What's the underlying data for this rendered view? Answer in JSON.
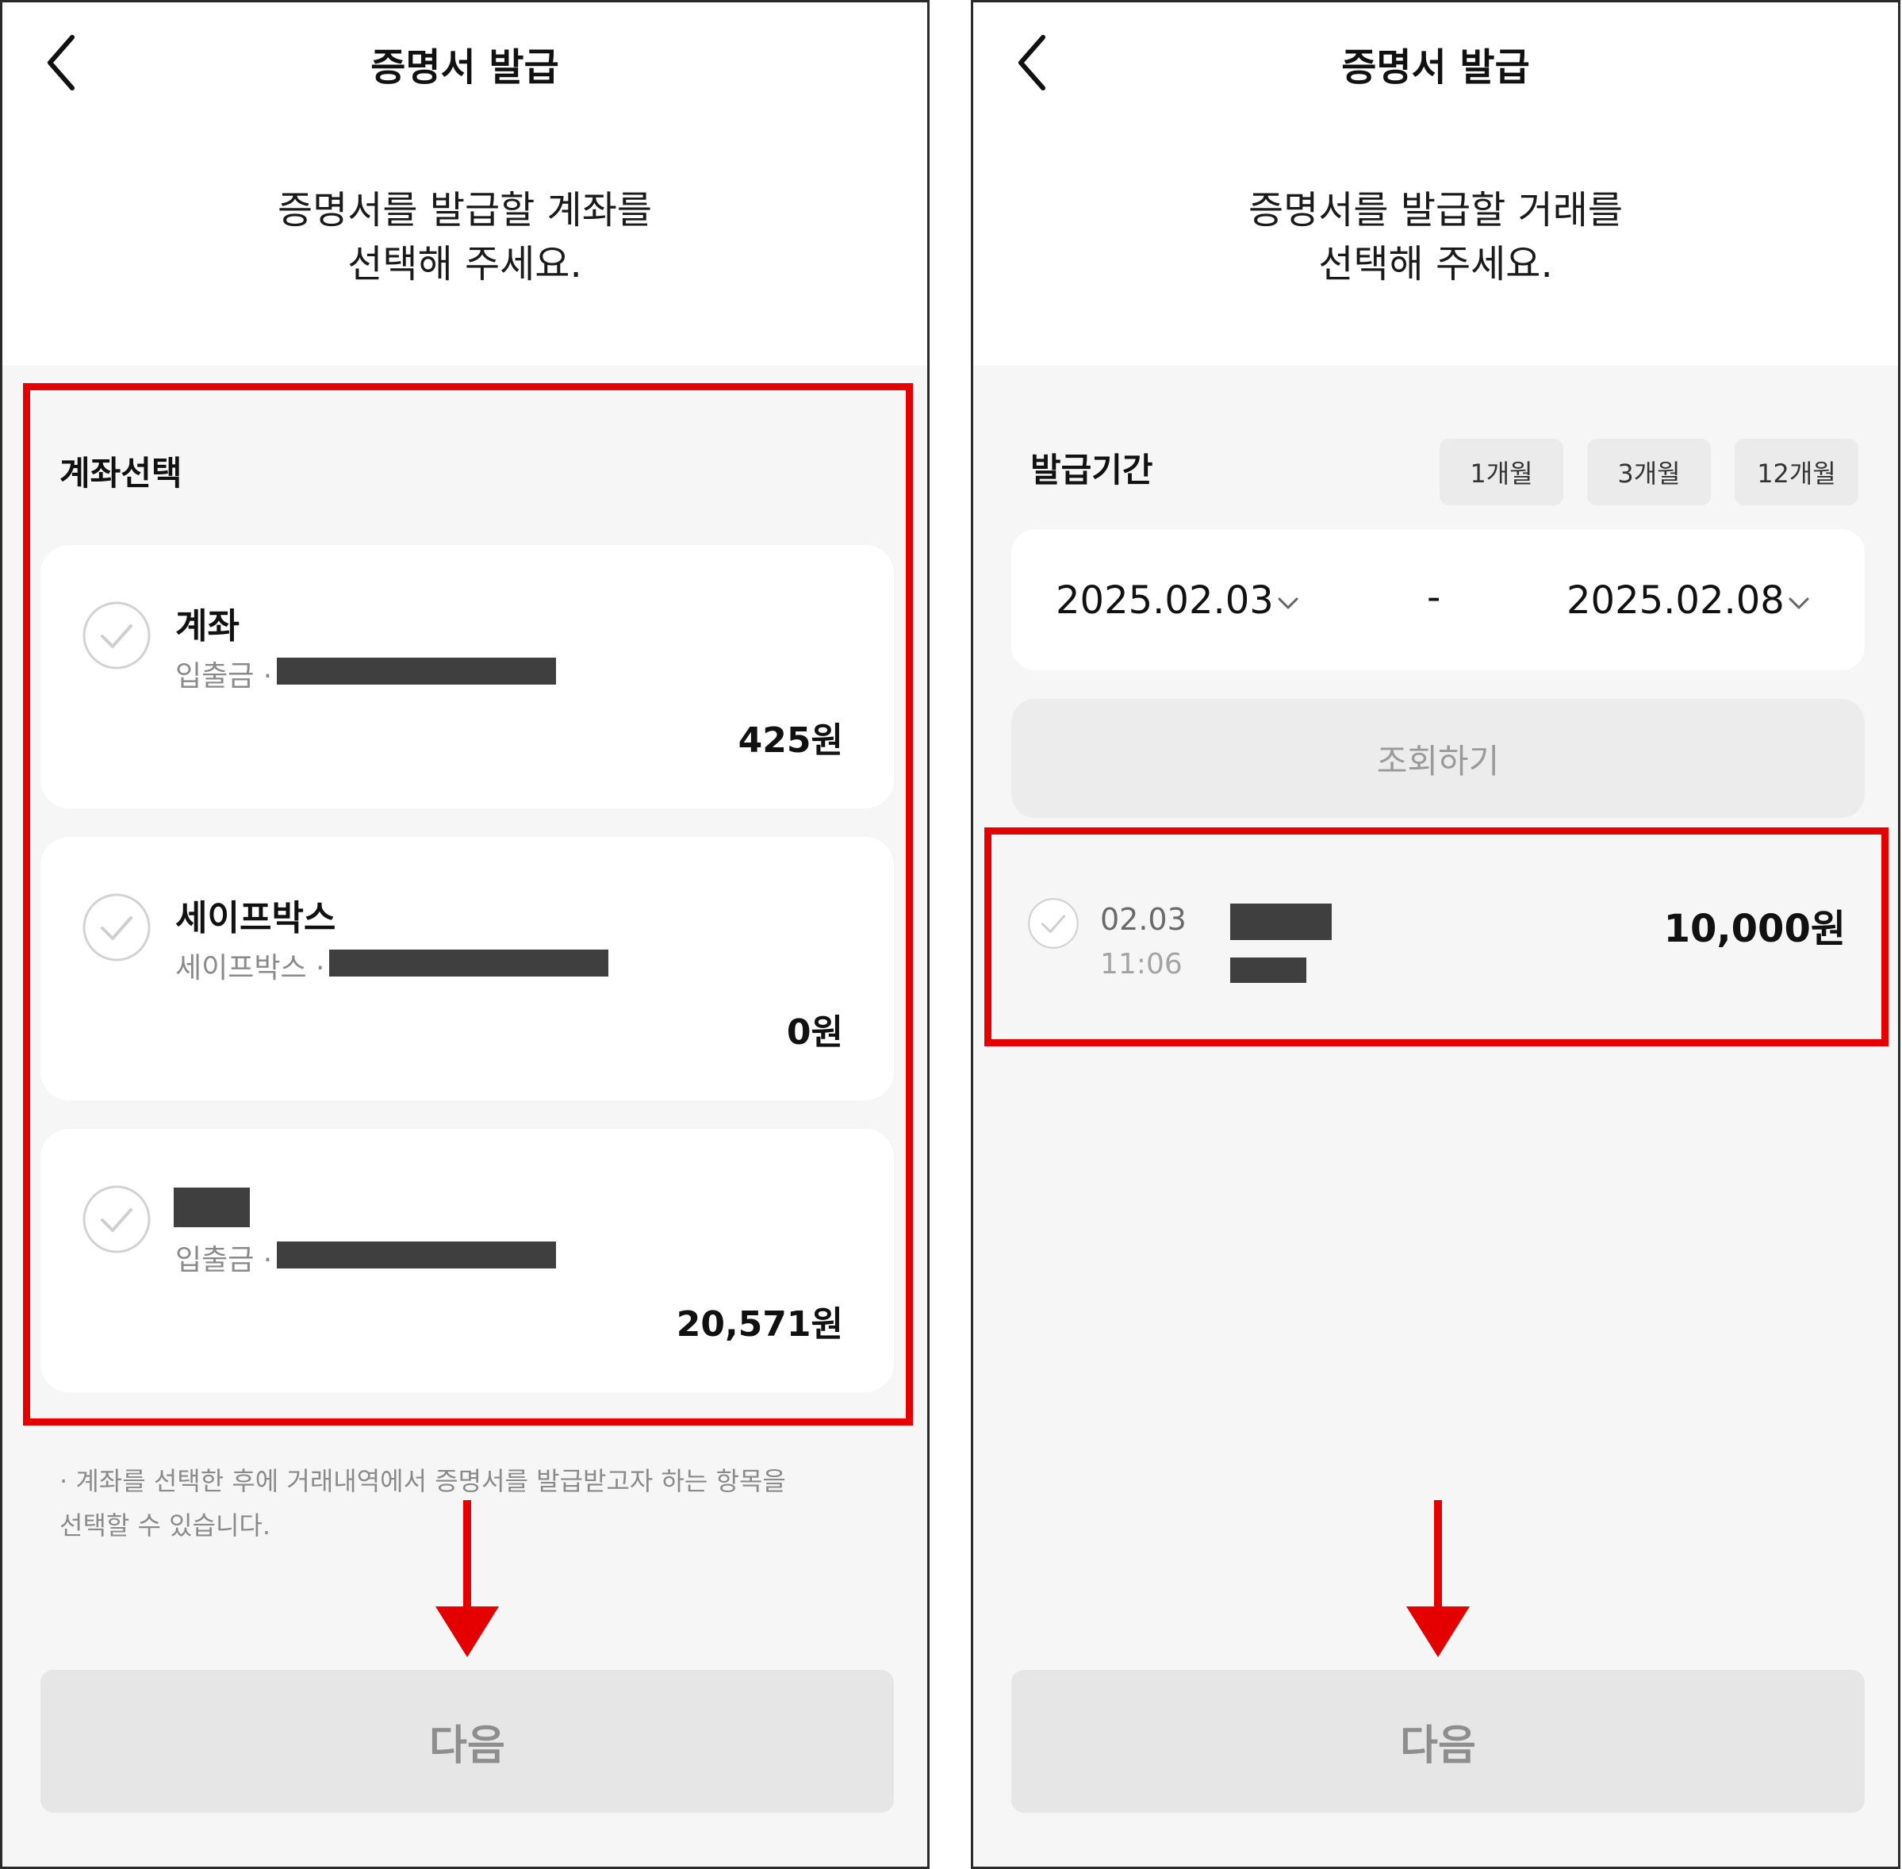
{
  "left_screen": {
    "title": "증명서 발급",
    "prompt_line1": "증명서를 발급할 계좌를",
    "prompt_line2": "선택해 주세요.",
    "section_title": "계좌선택",
    "accounts": [
      {
        "name": "계좌",
        "sub": "입출금 ·",
        "amount": "425원"
      },
      {
        "name": "세이프박스",
        "sub": "세이프박스 ·",
        "amount": "0원"
      },
      {
        "name": "",
        "sub": "입출금 ·",
        "amount": "20,571원"
      }
    ],
    "note_line1": "· 계좌를 선택한 후에 거래내역에서 증명서를 발급받고자 하는 항목을",
    "note_line2": "선택할 수 있습니다.",
    "next_label": "다음"
  },
  "right_screen": {
    "title": "증명서 발급",
    "prompt_line1": "증명서를 발급할 거래를",
    "prompt_line2": "선택해 주세요.",
    "period_label": "발급기간",
    "period_options": [
      "1개월",
      "3개월",
      "12개월"
    ],
    "start_date": "2025.02.03",
    "end_date": "2025.02.08",
    "date_separator": "-",
    "query_label": "조회하기",
    "transaction": {
      "date": "02.03",
      "time": "11:06",
      "amount": "10,000원"
    },
    "next_label": "다음"
  },
  "icons": {
    "back": "chevron-left-icon",
    "check": "check-circle-icon",
    "dropdown": "chevron-down-icon",
    "annotation": "red-arrow-down"
  },
  "colors": {
    "highlight": "#e50000",
    "gray_background": "#f6f6f6",
    "redaction": "#3f3f3f",
    "disabled_button": "#e6e6e6"
  }
}
